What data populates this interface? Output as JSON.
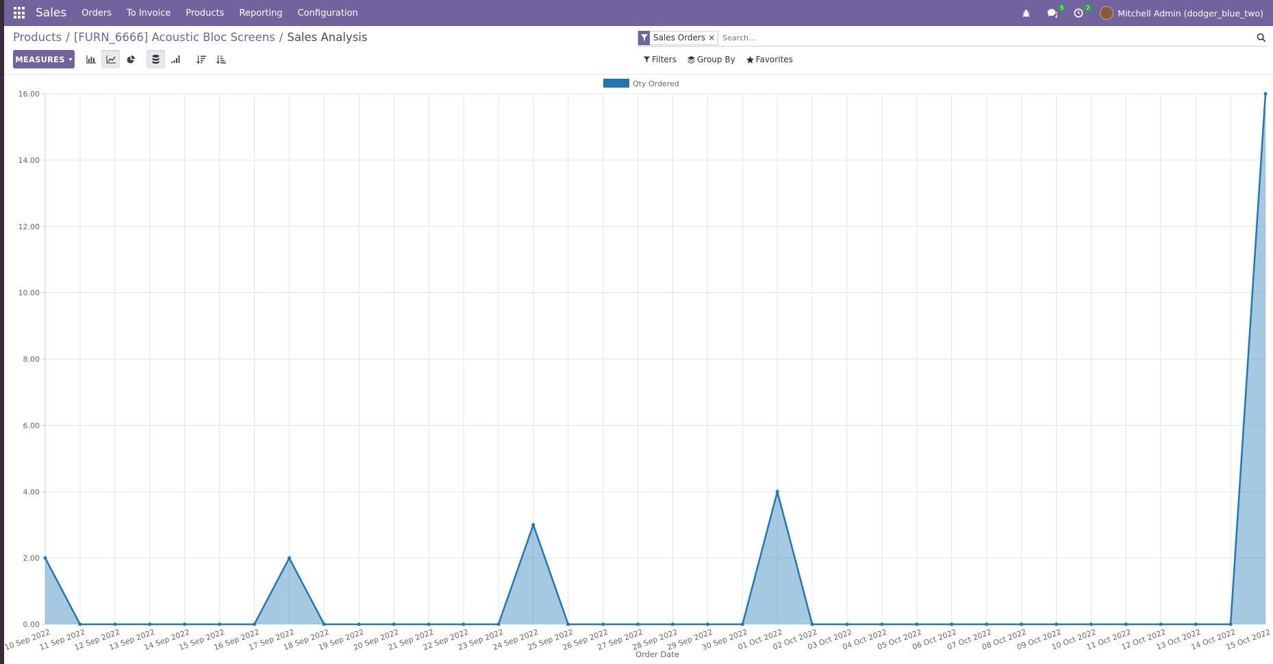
{
  "navbar": {
    "brand": "Sales",
    "menu": [
      "Orders",
      "To Invoice",
      "Products",
      "Reporting",
      "Configuration"
    ],
    "messages_count": "5",
    "activities_count": "2",
    "user": "Mitchell Admin (dodger_blue_two)",
    "color": "#71639e"
  },
  "breadcrumb": {
    "items": [
      "Products",
      "[FURN_6666] Acoustic Bloc Screens"
    ],
    "current": "Sales Analysis",
    "sep": "/"
  },
  "search": {
    "facet": "Sales Orders",
    "placeholder": "Search..."
  },
  "toolbar": {
    "measures_label": "MEASURES",
    "filters_label": "Filters",
    "groupby_label": "Group By",
    "favorites_label": "Favorites"
  },
  "chart_data": {
    "type": "line",
    "series": [
      {
        "name": "Qty Ordered",
        "color": "#1f77b4",
        "fill": "rgba(31,119,180,0.4)",
        "values": [
          2,
          0,
          0,
          0,
          0,
          0,
          0,
          2,
          0,
          0,
          0,
          0,
          0,
          0,
          3,
          0,
          0,
          0,
          0,
          0,
          0,
          4,
          0,
          0,
          0,
          0,
          0,
          0,
          0,
          0,
          0,
          0,
          0,
          0,
          0,
          16
        ]
      }
    ],
    "categories": [
      "10 Sep 2022",
      "11 Sep 2022",
      "12 Sep 2022",
      "13 Sep 2022",
      "14 Sep 2022",
      "15 Sep 2022",
      "16 Sep 2022",
      "17 Sep 2022",
      "18 Sep 2022",
      "19 Sep 2022",
      "20 Sep 2022",
      "21 Sep 2022",
      "22 Sep 2022",
      "23 Sep 2022",
      "24 Sep 2022",
      "25 Sep 2022",
      "26 Sep 2022",
      "27 Sep 2022",
      "28 Sep 2022",
      "29 Sep 2022",
      "30 Sep 2022",
      "01 Oct 2022",
      "02 Oct 2022",
      "03 Oct 2022",
      "04 Oct 2022",
      "05 Oct 2022",
      "06 Oct 2022",
      "07 Oct 2022",
      "08 Oct 2022",
      "09 Oct 2022",
      "10 Oct 2022",
      "11 Oct 2022",
      "12 Oct 2022",
      "13 Oct 2022",
      "14 Oct 2022",
      "15 Oct 2022"
    ],
    "y_ticks": [
      "0.00",
      "2.00",
      "4.00",
      "6.00",
      "8.00",
      "10.00",
      "12.00",
      "14.00",
      "16.00"
    ],
    "ylim": [
      0,
      16
    ],
    "xlabel": "Order Date",
    "ylabel": "",
    "legend_position": "top",
    "grid": true
  }
}
